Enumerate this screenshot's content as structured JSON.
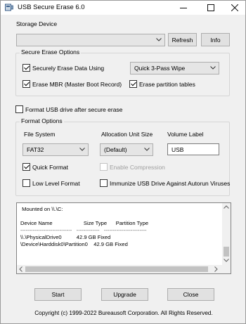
{
  "window": {
    "title": "USB Secure Erase 6.0",
    "icon": "usb-app-icon",
    "controls": {
      "minimize": "–",
      "maximize": "☐",
      "close": "✕"
    }
  },
  "storage": {
    "label": "Storage Device",
    "selected_value": "",
    "refresh_label": "Refresh",
    "info_label": "Info"
  },
  "secure_erase": {
    "group_label": "Secure Erase Options",
    "securely_erase_label": "Securely Erase Data Using",
    "securely_erase_checked": true,
    "method_value": "Quick 3-Pass Wipe",
    "erase_mbr_label": "Erase MBR (Master Boot Record)",
    "erase_mbr_checked": true,
    "erase_partitions_label": "Erase partition tables",
    "erase_partitions_checked": true
  },
  "format_after": {
    "label": "Format USB drive after secure erase",
    "checked": false
  },
  "format_options": {
    "group_label": "Format Options",
    "fs_label": "File System",
    "fs_value": "FAT32",
    "alloc_label": "Allocation Unit Size",
    "alloc_value": "(Default)",
    "volume_label": "Volume Label",
    "volume_value": "USB",
    "quick_format_label": "Quick Format",
    "quick_format_checked": true,
    "enable_compression_label": "Enable Compression",
    "enable_compression_checked": false,
    "low_level_label": "Low Level Format",
    "low_level_checked": false,
    "immunize_label": "Immunize USB Drive Against Autorun Viruses",
    "immunize_checked": false
  },
  "log": {
    "lines": [
      " Mounted on \\\\.\\C:",
      "",
      "Device Name                     Size Type      Partition Type",
      "-----------------------------   -------------   ------------------------",
      "\\\\.\\PhysicalDrive0          42.9 GB Fixed",
      "\\Device\\Harddisk0\\Partition0    42.9 GB Fixed"
    ]
  },
  "actions": {
    "start_label": "Start",
    "upgrade_label": "Upgrade",
    "close_label": "Close"
  },
  "footer": {
    "copyright": "Copyright (c) 1999-2022 Bureausoft Corporation. All Rights Reserved."
  }
}
